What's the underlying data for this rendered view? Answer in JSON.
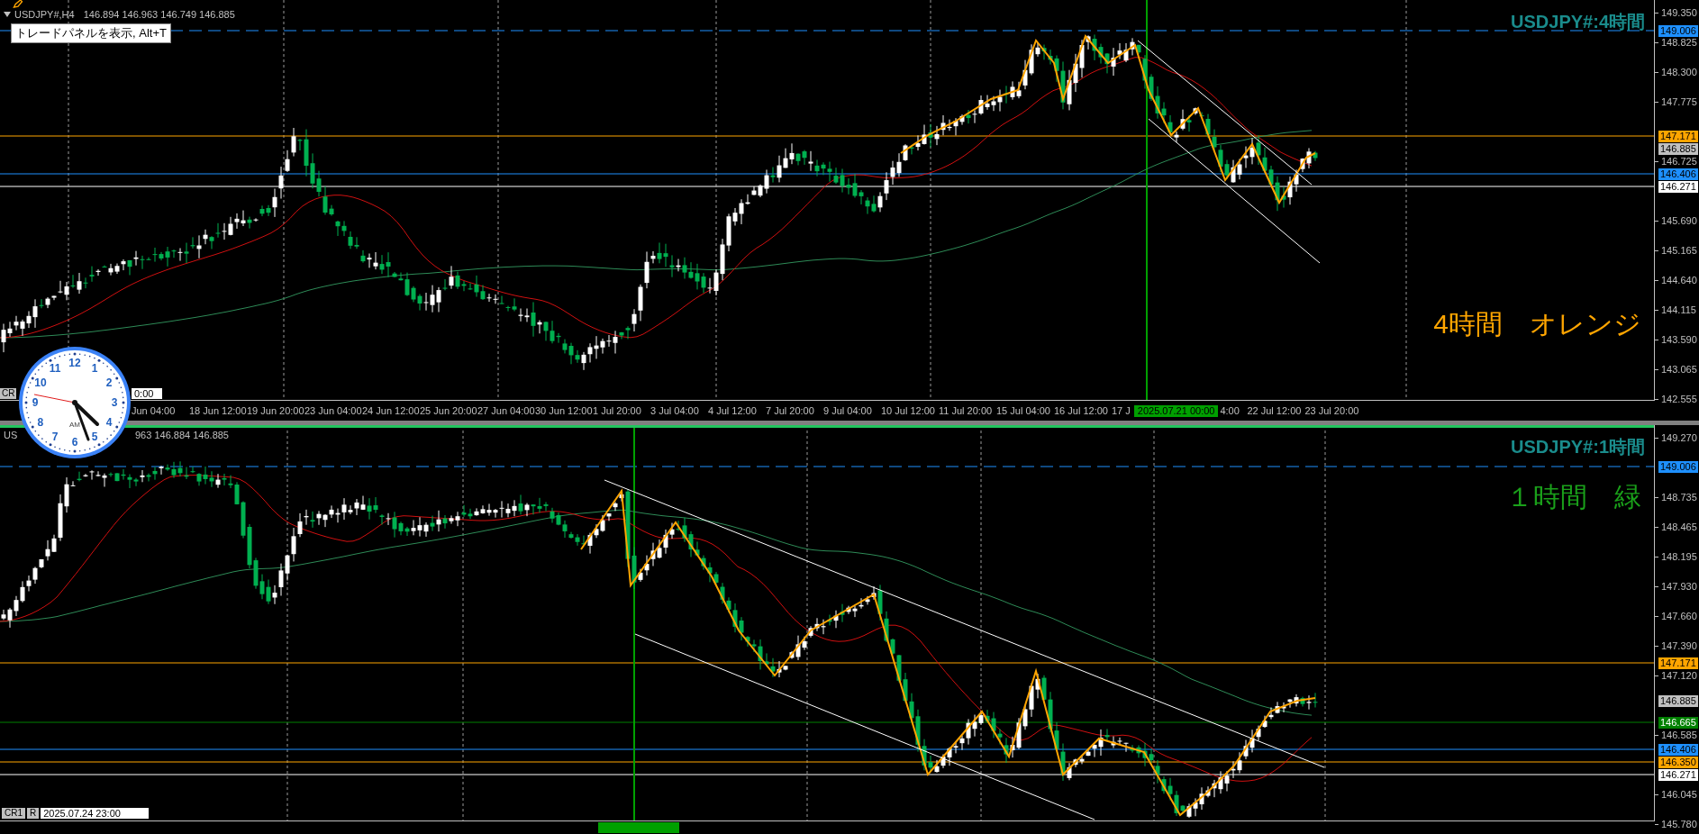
{
  "top_chart": {
    "symbol": "USDJPY#,H4",
    "quotes": "146.894 146.963 146.749 146.885",
    "tooltip": "トレードパネルを表示, Alt+T",
    "title": "USDJPY#:4時間",
    "note": "4時間　オレンジ",
    "price_labels": [
      "149.350",
      "148.825",
      "148.300",
      "147.775",
      "146.725",
      "145.690",
      "145.165",
      "144.640",
      "144.115",
      "143.590",
      "143.065",
      "142.555"
    ],
    "price_tags": [
      {
        "text": "149.006",
        "color": "#1e90ff",
        "kind": "dashed"
      },
      {
        "text": "147.171",
        "color": "#ffa500",
        "kind": "solid"
      },
      {
        "text": "146.885",
        "color": "#c0c0c0",
        "kind": "unlined"
      },
      {
        "text": "146.406",
        "color": "#1e90ff",
        "kind": "solid"
      },
      {
        "text": "146.271",
        "color": "#ffffff",
        "kind": "solid"
      }
    ],
    "time_labels": [
      "Jun 04:00",
      "18 Jun 12:00",
      "19 Jun 20:00",
      "23 Jun 04:00",
      "24 Jun 12:00",
      "25 Jun 20:00",
      "27 Jun 04:00",
      "30 Jun 12:00",
      "1 Jul 20:00",
      "3 Jul 04:00",
      "4 Jul 12:00",
      "7 Jul 20:00",
      "9 Jul 04:00",
      "10 Jul 12:00",
      "11 Jul 20:00",
      "15 Jul 04:00",
      "16 Jul 12:00",
      "17 J"
    ],
    "crosshair_time": "2025.07.21 00:00",
    "time_labels_after": [
      "4:00",
      "22 Jul 12:00",
      "23 Jul 20:00"
    ],
    "corner_button": "CR",
    "corner_field": "0:00"
  },
  "bottom_chart": {
    "symbol": "US",
    "quotes": "963 146.884 146.885",
    "title": "USDJPY#:1時間",
    "note": "１時間　緑",
    "price_labels": [
      "149.270",
      "148.735",
      "148.465",
      "148.195",
      "147.930",
      "147.660",
      "147.390",
      "147.120",
      "146.585",
      "146.045",
      "145.780"
    ],
    "price_tags": [
      {
        "text": "149.006",
        "color": "#1e90ff",
        "kind": "dashed"
      },
      {
        "text": "147.171",
        "color": "#ffa500",
        "kind": "solid"
      },
      {
        "text": "146.885",
        "color": "#c0c0c0",
        "kind": "unlined"
      },
      {
        "text": "146.665",
        "color": "#008000",
        "kind": "solid"
      },
      {
        "text": "146.406",
        "color": "#1e90ff",
        "kind": "solid"
      },
      {
        "text": "146.350",
        "color": "#ffa500",
        "kind": "solid"
      },
      {
        "text": "146.271",
        "color": "#ffffff",
        "kind": "solid"
      }
    ],
    "buttons": [
      "CR1",
      "R"
    ],
    "time_field": "2025.07.24 23:00"
  },
  "clock": {
    "numerals": [
      "12",
      "1",
      "2",
      "3",
      "4",
      "5",
      "6",
      "7",
      "8",
      "9",
      "10",
      "11"
    ],
    "period": "AM"
  }
}
